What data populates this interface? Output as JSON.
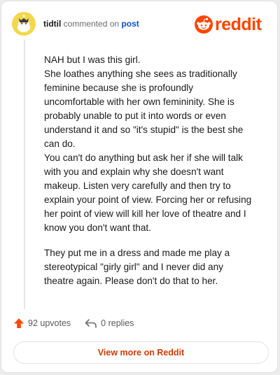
{
  "comment": {
    "author": "tidtil",
    "action_text": "commented on",
    "target_text": "post",
    "avatar_icon": "snoo-avatar-icon",
    "paragraphs": [
      "NAH but I was this girl.",
      "She loathes anything she sees as traditionally feminine because she is profoundly uncomfortable with her own femininity. She is probably unable to put it into words or even understand it and so \"it's stupid\" is the best she can do.",
      "You can't do anything but ask her if she will talk with you and explain why she doesn't want makeup. Listen very carefully and then try to explain your point of view. Forcing her or refusing her point of view will kill her love of theatre and I know you don't want that.",
      "They put me in a dress and made me play a stereotypical \"girly girl\" and I never did any theatre again. Please don't do that to her."
    ],
    "upvotes": "92 upvotes",
    "replies": "0 replies"
  },
  "branding": {
    "logo_text": "reddit",
    "logo_icon": "reddit-snoo-icon",
    "brand_color": "#ff4500"
  },
  "footer": {
    "view_more_label": "View more on Reddit"
  }
}
